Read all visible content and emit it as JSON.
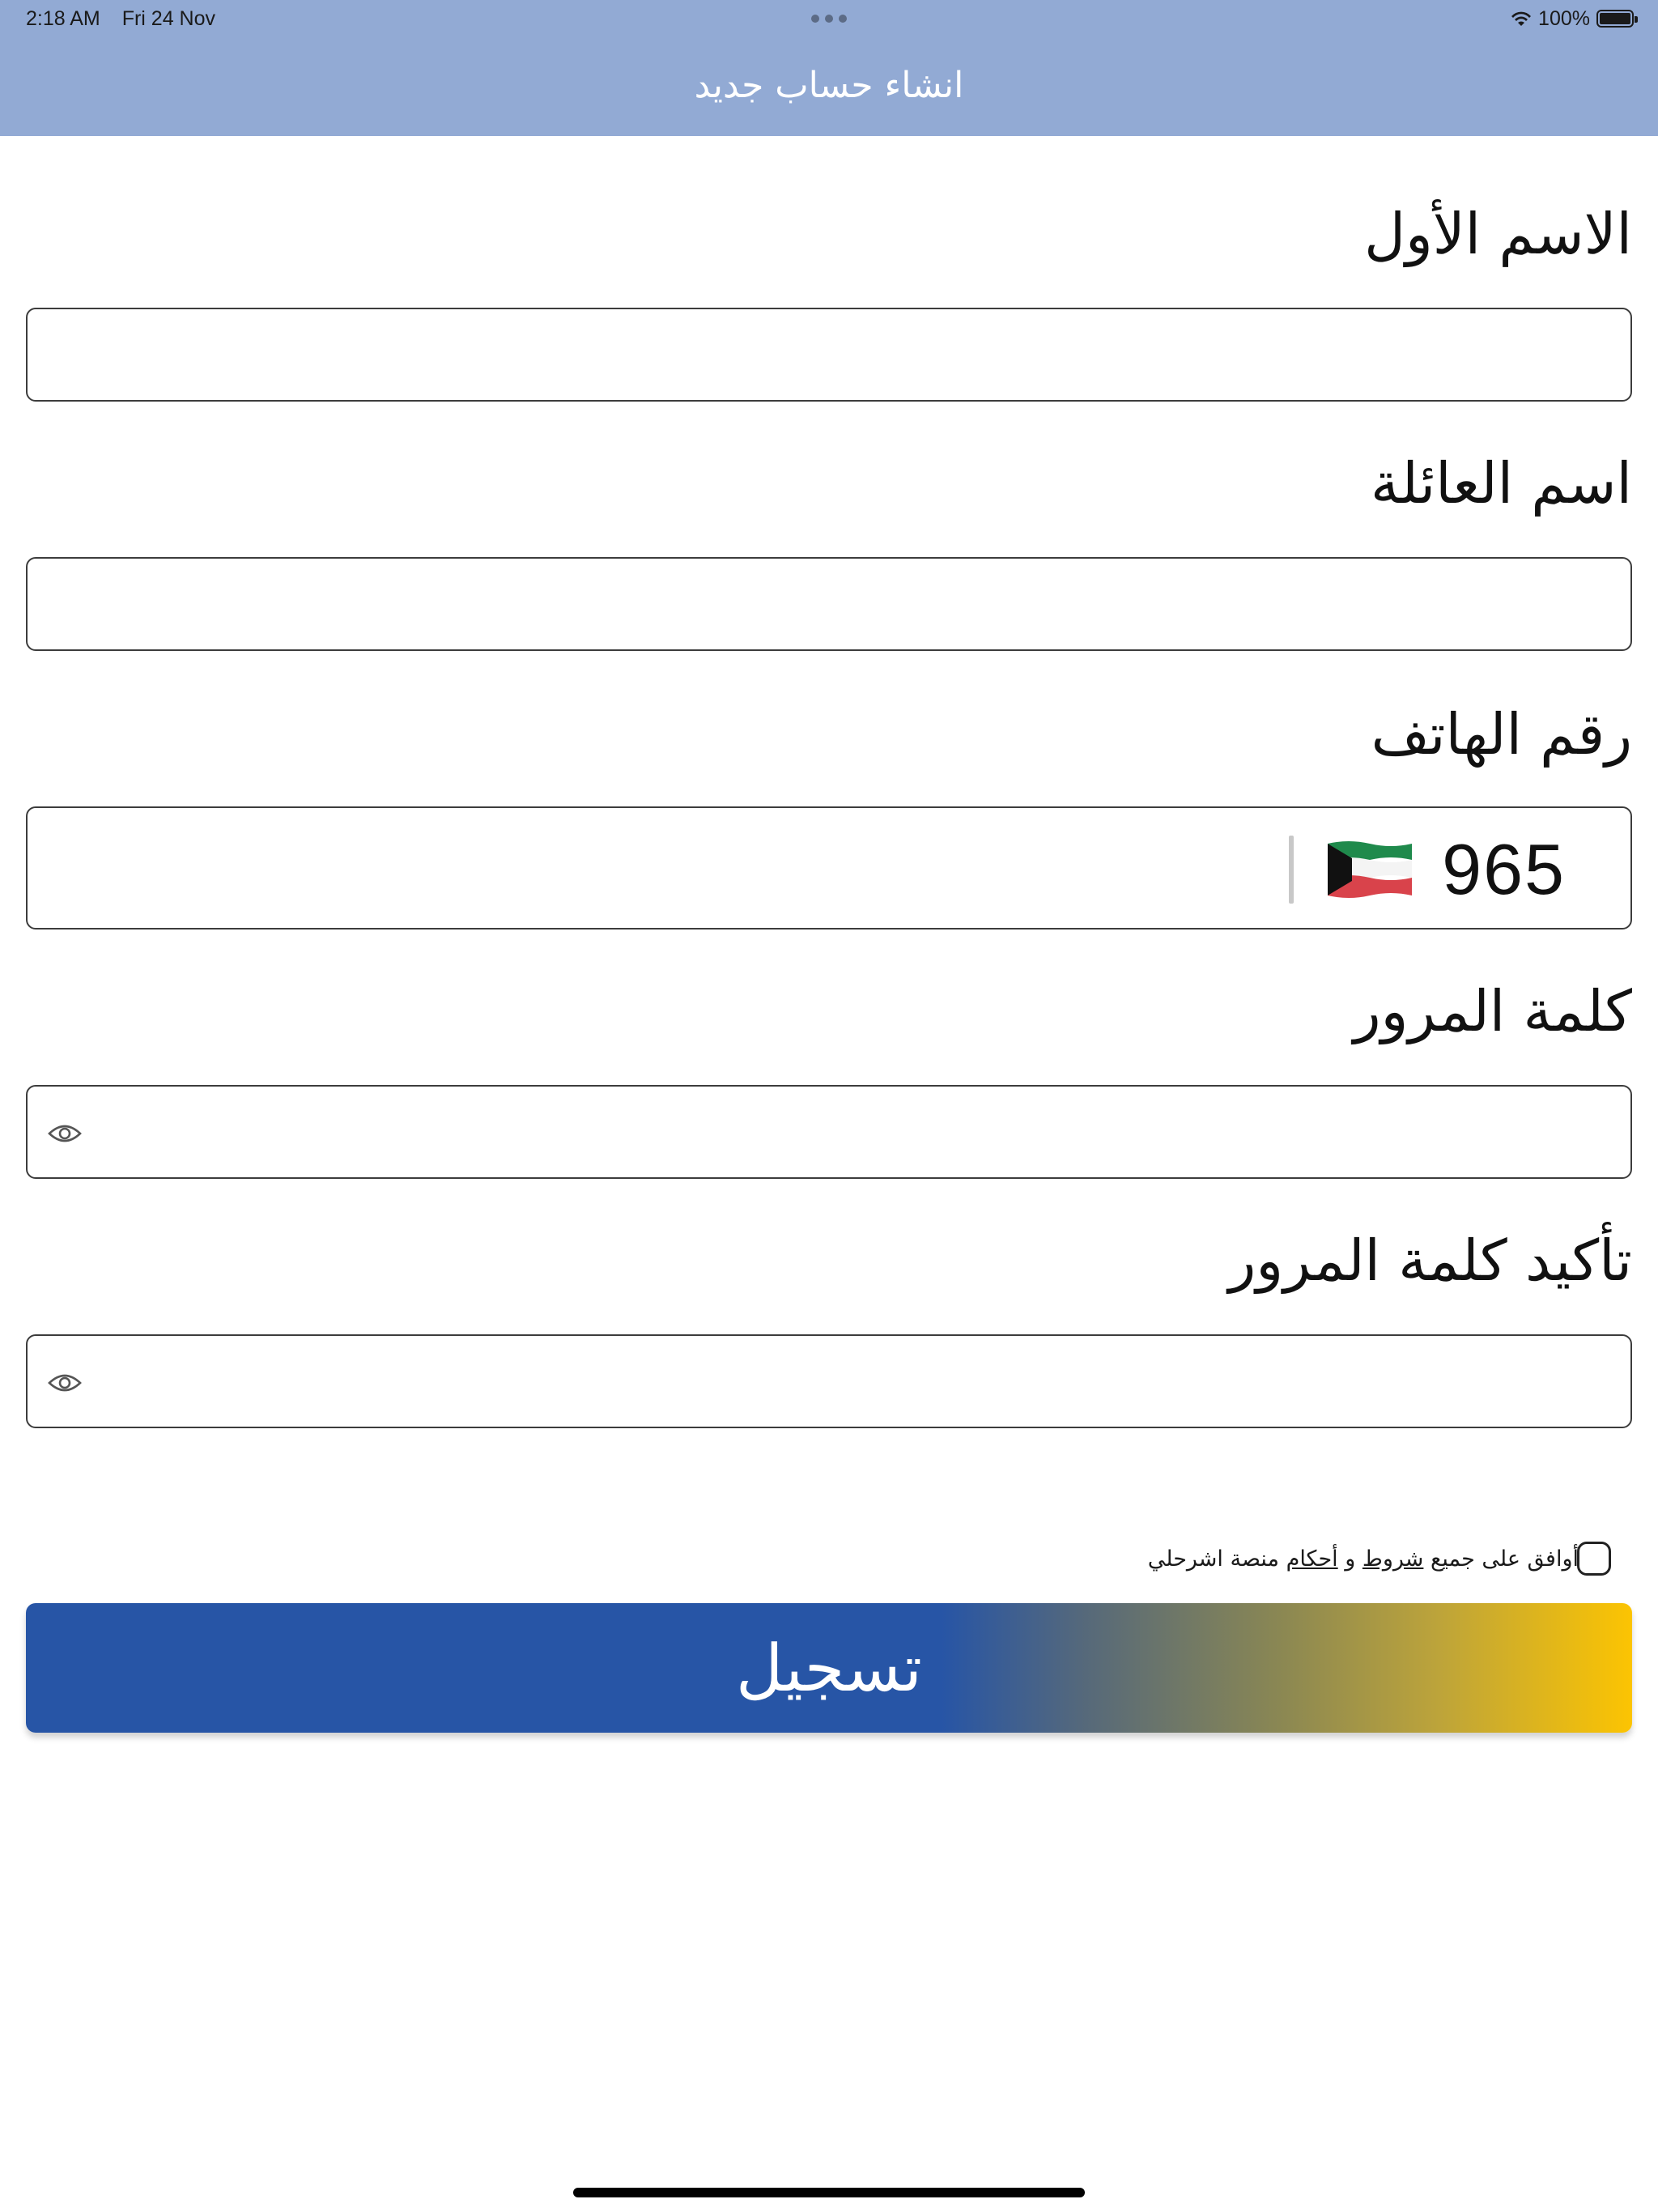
{
  "status_bar": {
    "time": "2:18 AM",
    "date": "Fri 24 Nov",
    "battery_percent": "100%",
    "icons": [
      "multitask-dots-icon",
      "wifi-icon",
      "battery-icon"
    ]
  },
  "header": {
    "title": "انشاء حساب جديد",
    "background_color": "#92aad4"
  },
  "form": {
    "first_name": {
      "label": "الاسم الأول",
      "value": ""
    },
    "last_name": {
      "label": "اسم العائلة",
      "value": ""
    },
    "phone": {
      "label": "رقم الهاتف",
      "country_code": "965",
      "flag_icon": "kuwait-flag-icon",
      "value": ""
    },
    "password": {
      "label": "كلمة المرور",
      "value": "",
      "toggle_icon": "eye-icon"
    },
    "confirm_password": {
      "label": "تأكيد كلمة المرور",
      "value": "",
      "toggle_icon": "eye-icon"
    }
  },
  "terms": {
    "checked": false,
    "text_before": "أوافق على جميع ",
    "terms_link": "شروط",
    "and": " و ",
    "conditions_link": "أحكام",
    "text_after": " منصة اشرحلي"
  },
  "register_button": {
    "label": "تسجيل",
    "gradient_colors": [
      "#2755a6",
      "#fcc402"
    ]
  }
}
